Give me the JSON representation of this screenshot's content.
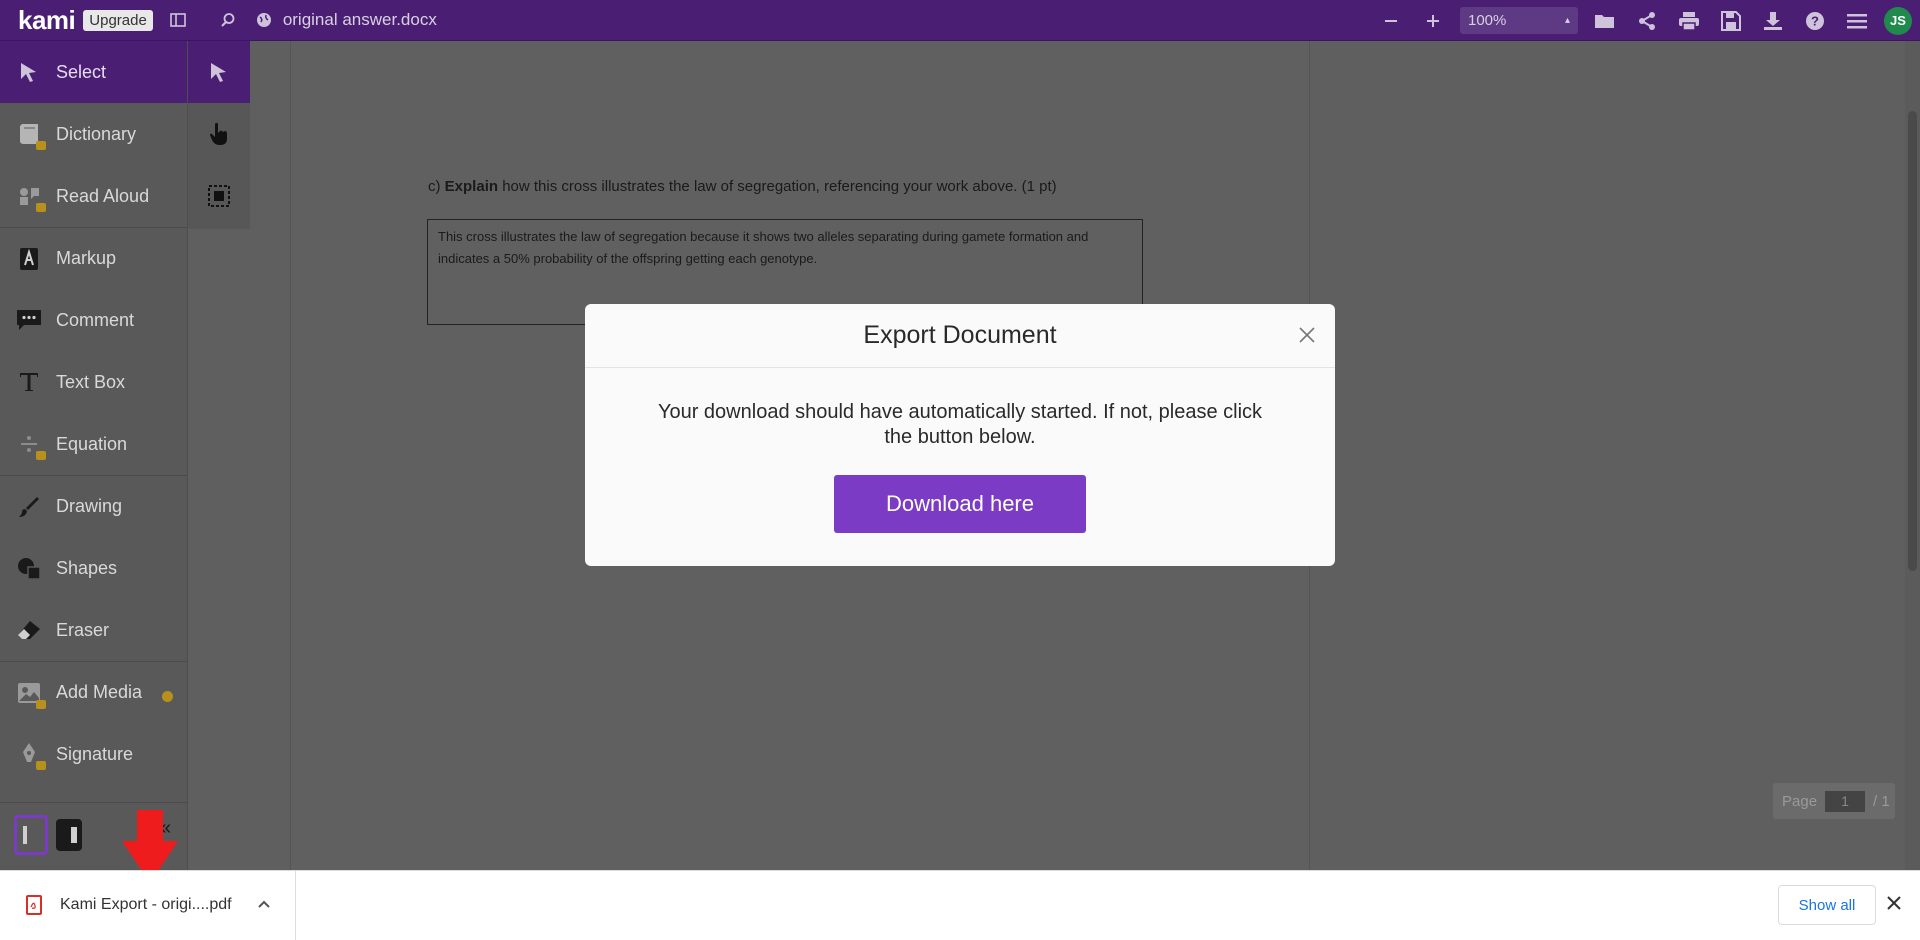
{
  "app": {
    "logo": "kami",
    "upgrade_label": "Upgrade",
    "filename": "original answer.docx",
    "zoom": "100%",
    "avatar": "JS",
    "accent_color": "#4a1f73",
    "button_color": "#7b3bc4"
  },
  "toolbar_icons": [
    "sidebar-toggle-icon",
    "search-icon",
    "globe-icon",
    "zoom-out-icon",
    "zoom-in-icon",
    "open-folder-icon",
    "share-icon",
    "print-icon",
    "save-icon",
    "download-icon",
    "help-icon",
    "menu-icon"
  ],
  "sidebar": {
    "items": [
      {
        "label": "Select",
        "icon": "cursor-icon",
        "locked": false
      },
      {
        "label": "Dictionary",
        "icon": "book-icon",
        "locked": true
      },
      {
        "label": "Read Aloud",
        "icon": "speaker-icon",
        "locked": true
      },
      {
        "label": "Markup",
        "icon": "highlighter-icon",
        "locked": false
      },
      {
        "label": "Comment",
        "icon": "comment-icon",
        "locked": false
      },
      {
        "label": "Text Box",
        "icon": "text-icon",
        "locked": false
      },
      {
        "label": "Equation",
        "icon": "divide-icon",
        "locked": true
      },
      {
        "label": "Drawing",
        "icon": "brush-icon",
        "locked": false
      },
      {
        "label": "Shapes",
        "icon": "shapes-icon",
        "locked": false
      },
      {
        "label": "Eraser",
        "icon": "eraser-icon",
        "locked": false
      },
      {
        "label": "Add Media",
        "icon": "image-icon",
        "locked": true
      },
      {
        "label": "Signature",
        "icon": "pen-icon",
        "locked": true
      }
    ]
  },
  "document": {
    "question_prefix": "c)",
    "question_bold": "Explain",
    "question_rest": "how this cross illustrates the law of segregation, referencing your work above. (1 pt)",
    "answer_text": "This cross illustrates the law of segregation because it shows two alleles separating during gamete formation and indicates a 50% probability of the offspring getting each genotype."
  },
  "page_indicator": {
    "label": "Page",
    "current": "1",
    "total": "/ 1"
  },
  "modal": {
    "title": "Export Document",
    "message": "Your download should have automatically started. If not, please click the button below.",
    "button_label": "Download here"
  },
  "download_bar": {
    "file_name": "Kami Export - origi....pdf",
    "show_all_label": "Show all"
  }
}
